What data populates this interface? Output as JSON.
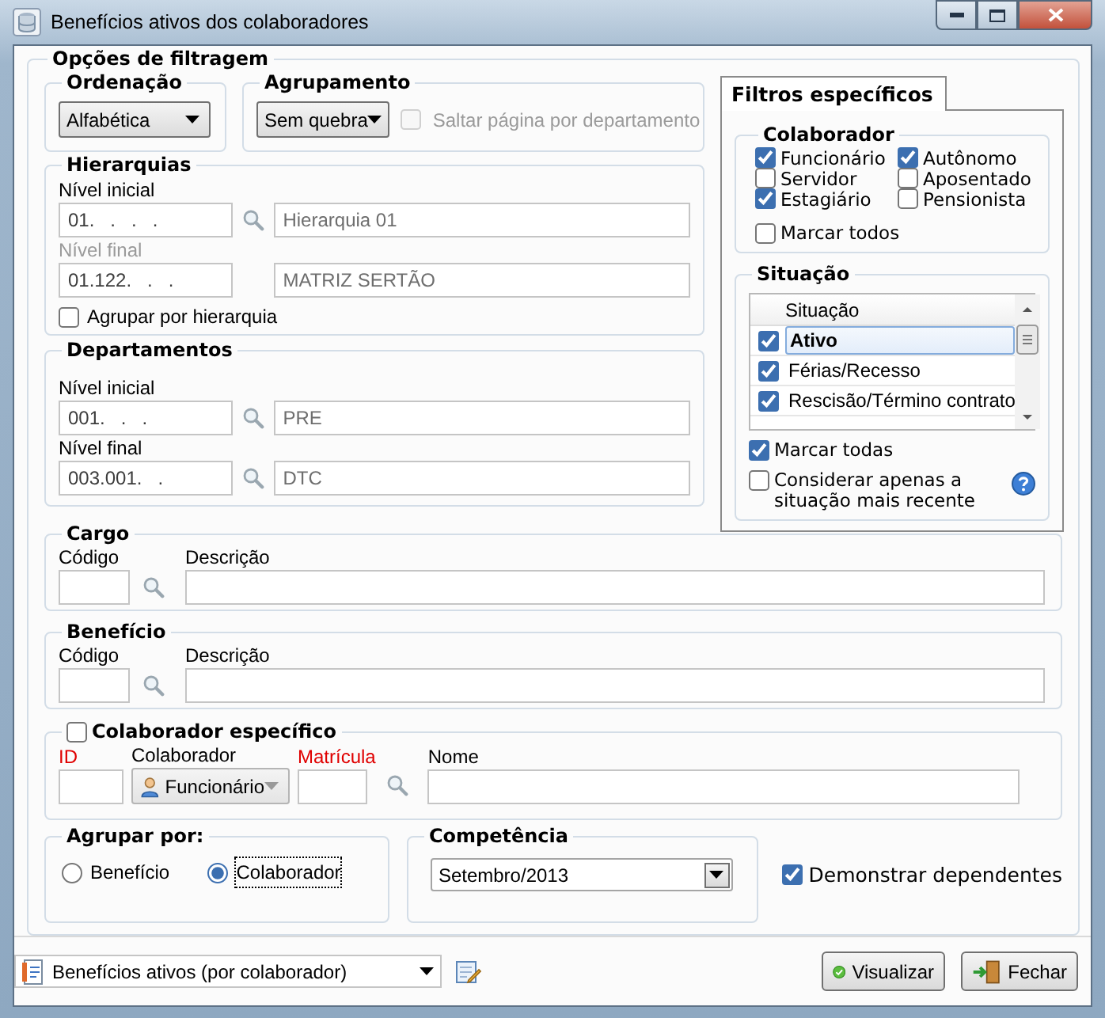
{
  "window": {
    "title": "Benefícios ativos dos colaboradores"
  },
  "filter_group": {
    "title": "Opções de filtragem"
  },
  "ordenacao": {
    "title": "Ordenação",
    "value": "Alfabética"
  },
  "agrupamento": {
    "title": "Agrupamento",
    "value": "Sem quebra",
    "skip_page": {
      "label": "Saltar página por departamento",
      "checked": false,
      "disabled": true
    }
  },
  "hierarquias": {
    "title": "Hierarquias",
    "levels": [
      {
        "label": "Nível inicial",
        "code": "01.   .   .   .",
        "description": "Hierarquia 01",
        "disabled": false
      },
      {
        "label": "Nível final",
        "code": "01.122.   .   .",
        "description": "MATRIZ SERTÃO",
        "disabled": true
      }
    ],
    "group_by": {
      "label": "Agrupar por hierarquia",
      "checked": false
    }
  },
  "departamentos": {
    "title": "Departamentos",
    "levels": [
      {
        "label": "Nível inicial",
        "code": "001.   .   .",
        "description": "PRE",
        "disabled": false
      },
      {
        "label": "Nível final",
        "code": "003.001.   .",
        "description": "DTC",
        "disabled": false
      }
    ]
  },
  "specific_filters": {
    "tab": "Filtros específicos",
    "colaborador": {
      "title": "Colaborador",
      "options": [
        {
          "label": "Funcionário",
          "checked": true
        },
        {
          "label": "Autônomo",
          "checked": true
        },
        {
          "label": "Servidor",
          "checked": false
        },
        {
          "label": "Aposentado",
          "checked": false
        },
        {
          "label": "Estagiário",
          "checked": true
        },
        {
          "label": "Pensionista",
          "checked": false
        }
      ],
      "mark_all": {
        "label": "Marcar todos",
        "checked": false
      }
    },
    "situacao": {
      "title": "Situação",
      "column": "Situação",
      "rows": [
        {
          "label": "Ativo",
          "checked": true,
          "selected": true
        },
        {
          "label": "Férias/Recesso",
          "checked": true,
          "selected": false
        },
        {
          "label": "Rescisão/Término contrato",
          "checked": true,
          "selected": false
        }
      ],
      "mark_all": {
        "label": "Marcar todas",
        "checked": true
      },
      "most_recent": {
        "label": "Considerar apenas a situação mais recente",
        "checked": false
      }
    }
  },
  "cargo": {
    "title": "Cargo",
    "code_label": "Código",
    "description_label": "Descrição"
  },
  "beneficio": {
    "title": "Benefício",
    "code_label": "Código",
    "description_label": "Descrição"
  },
  "colaborador_especifico": {
    "title": "Colaborador específico",
    "checked": false,
    "id_label": "ID",
    "type_label": "Colaborador",
    "type_value": "Funcionário",
    "registration_label": "Matrícula",
    "name_label": "Nome"
  },
  "agrupar_por": {
    "title": "Agrupar por:",
    "options": [
      {
        "label": "Benefício",
        "selected": false
      },
      {
        "label": "Colaborador",
        "selected": true
      }
    ]
  },
  "competencia": {
    "title": "Competência",
    "value": "Setembro/2013"
  },
  "show_dependents": {
    "label": "Demonstrar dependentes",
    "checked": true
  },
  "footer": {
    "report": "Benefícios ativos (por colaborador)",
    "buttons": [
      {
        "label": "Visualizar",
        "kind": "ok"
      },
      {
        "label": "Fechar",
        "kind": "close"
      }
    ]
  }
}
